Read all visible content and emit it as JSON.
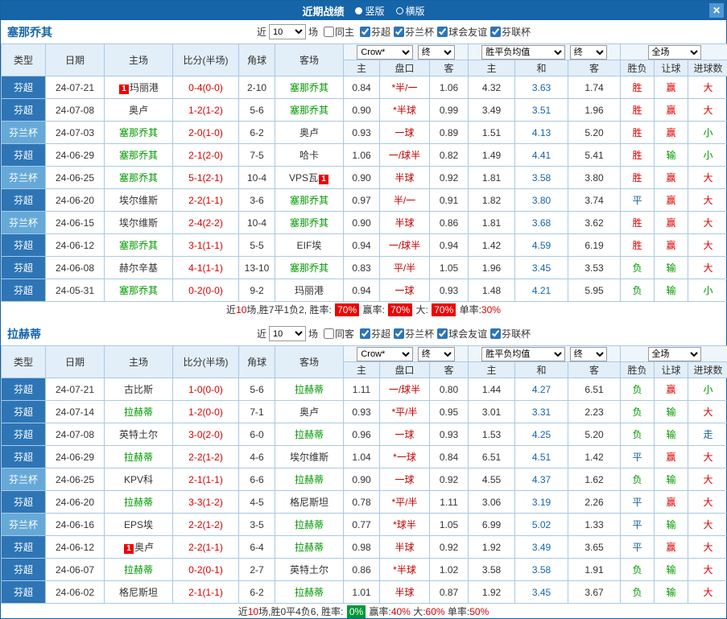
{
  "window": {
    "title": "近期战绩",
    "view_vertical": "竖版",
    "view_horizontal": "横版",
    "close_label": "✕"
  },
  "controls": {
    "near": "近",
    "count": "10",
    "games": "场",
    "bookmaker": "Crow*",
    "final": "终",
    "wdl_avg": "胜平负均值",
    "full": "全场"
  },
  "table_headers": {
    "type": "类型",
    "date": "日期",
    "home": "主场",
    "score": "比分(半场)",
    "corner": "角球",
    "away": "客场",
    "asian_home": "主",
    "handicap": "盘口",
    "asian_away": "客",
    "avg_home": "主",
    "avg_draw": "和",
    "avg_away": "客",
    "wdl": "胜负",
    "let_ball": "让球",
    "goals": "进球数"
  },
  "league_colors": {
    "芬超": "#2e75b6",
    "芬兰杯": "#66a9d8"
  },
  "result_colors": {
    "胜": "#dd0000",
    "平": "#1565a8",
    "负": "#009900",
    "赢": "#dd0000",
    "输": "#009900",
    "走": "#1565a8",
    "大": "#dd0000",
    "小": "#009900"
  },
  "sections": [
    {
      "team": "塞那乔其",
      "same_filter": "同主",
      "league_filters": [
        "芬超",
        "芬兰杯",
        "球会友谊",
        "芬联杯"
      ],
      "rows": [
        {
          "league": "芬超",
          "date": "24-07-21",
          "home": "玛丽港",
          "home_badge": "1",
          "score": "0-4(0-0)",
          "corner": "2-10",
          "away": "塞那乔其",
          "ah_home": "0.84",
          "handicap": "*半/一",
          "ah_away": "1.06",
          "avg_home": "4.32",
          "avg_draw": "3.63",
          "avg_away": "1.74",
          "wdl": "胜",
          "let_ball": "赢",
          "goals": "大"
        },
        {
          "league": "芬超",
          "date": "24-07-08",
          "home": "奥卢",
          "score": "1-2(1-2)",
          "corner": "5-6",
          "away": "塞那乔其",
          "ah_home": "0.90",
          "handicap": "*半球",
          "ah_away": "0.99",
          "avg_home": "3.49",
          "avg_draw": "3.51",
          "avg_away": "1.96",
          "wdl": "胜",
          "let_ball": "赢",
          "goals": "大"
        },
        {
          "league": "芬兰杯",
          "date": "24-07-03",
          "home": "塞那乔其",
          "score": "2-0(1-0)",
          "corner": "6-2",
          "away": "奥卢",
          "ah_home": "0.93",
          "handicap": "一球",
          "ah_away": "0.89",
          "avg_home": "1.51",
          "avg_draw": "4.13",
          "avg_away": "5.20",
          "wdl": "胜",
          "let_ball": "赢",
          "goals": "小"
        },
        {
          "league": "芬超",
          "date": "24-06-29",
          "home": "塞那乔其",
          "score": "2-1(2-0)",
          "corner": "7-5",
          "away": "哈卡",
          "ah_home": "1.06",
          "handicap": "一/球半",
          "ah_away": "0.82",
          "avg_home": "1.49",
          "avg_draw": "4.41",
          "avg_away": "5.41",
          "wdl": "胜",
          "let_ball": "输",
          "goals": "小"
        },
        {
          "league": "芬兰杯",
          "date": "24-06-25",
          "home": "塞那乔其",
          "score": "5-1(2-1)",
          "corner": "10-4",
          "away": "VPS瓦",
          "away_badge": "1",
          "away_badge_after": true,
          "ah_home": "0.90",
          "handicap": "半球",
          "ah_away": "0.92",
          "avg_home": "1.81",
          "avg_draw": "3.58",
          "avg_away": "3.80",
          "wdl": "胜",
          "let_ball": "赢",
          "goals": "大"
        },
        {
          "league": "芬超",
          "date": "24-06-20",
          "home": "埃尔维斯",
          "score": "2-2(1-1)",
          "corner": "3-6",
          "away": "塞那乔其",
          "ah_home": "0.97",
          "handicap": "半/一",
          "ah_away": "0.91",
          "avg_home": "1.82",
          "avg_draw": "3.80",
          "avg_away": "3.74",
          "wdl": "平",
          "let_ball": "赢",
          "goals": "大"
        },
        {
          "league": "芬兰杯",
          "date": "24-06-15",
          "home": "埃尔维斯",
          "score": "2-4(2-2)",
          "corner": "10-4",
          "away": "塞那乔其",
          "ah_home": "0.90",
          "handicap": "半球",
          "ah_away": "0.86",
          "avg_home": "1.81",
          "avg_draw": "3.68",
          "avg_away": "3.62",
          "wdl": "胜",
          "let_ball": "赢",
          "goals": "大"
        },
        {
          "league": "芬超",
          "date": "24-06-12",
          "home": "塞那乔其",
          "score": "3-1(1-1)",
          "corner": "5-5",
          "away": "EIF埃",
          "ah_home": "0.94",
          "handicap": "一/球半",
          "ah_away": "0.94",
          "avg_home": "1.42",
          "avg_draw": "4.59",
          "avg_away": "6.19",
          "wdl": "胜",
          "let_ball": "赢",
          "goals": "大"
        },
        {
          "league": "芬超",
          "date": "24-06-08",
          "home": "赫尔辛基",
          "score": "4-1(1-1)",
          "corner": "13-10",
          "away": "塞那乔其",
          "ah_home": "0.83",
          "handicap": "平/半",
          "ah_away": "1.05",
          "avg_home": "1.96",
          "avg_draw": "3.45",
          "avg_away": "3.53",
          "wdl": "负",
          "let_ball": "输",
          "goals": "大"
        },
        {
          "league": "芬超",
          "date": "24-05-31",
          "home": "塞那乔其",
          "score": "0-2(0-0)",
          "corner": "9-2",
          "away": "玛丽港",
          "ah_home": "0.94",
          "handicap": "一球",
          "ah_away": "0.93",
          "avg_home": "1.48",
          "avg_draw": "4.21",
          "avg_away": "5.95",
          "wdl": "负",
          "let_ball": "输",
          "goals": "小"
        }
      ],
      "summary": [
        {
          "text": "近",
          "style": "plain"
        },
        {
          "text": "10",
          "style": "num"
        },
        {
          "text": "场,胜7平1负2, 胜率: ",
          "style": "plain"
        },
        {
          "text": "70%",
          "style": "box-red"
        },
        {
          "text": " 赢率: ",
          "style": "plain"
        },
        {
          "text": "70%",
          "style": "box-red"
        },
        {
          "text": " 大: ",
          "style": "plain"
        },
        {
          "text": "70%",
          "style": "box-red"
        },
        {
          "text": " 单率:",
          "style": "plain"
        },
        {
          "text": "30%",
          "style": "num"
        }
      ]
    },
    {
      "team": "拉赫蒂",
      "same_filter": "同客",
      "league_filters": [
        "芬超",
        "芬兰杯",
        "球会友谊",
        "芬联杯"
      ],
      "rows": [
        {
          "league": "芬超",
          "date": "24-07-21",
          "home": "古比斯",
          "score": "1-0(0-0)",
          "corner": "5-6",
          "away": "拉赫蒂",
          "ah_home": "1.11",
          "handicap": "一/球半",
          "ah_away": "0.80",
          "avg_home": "1.44",
          "avg_draw": "4.27",
          "avg_away": "6.51",
          "wdl": "负",
          "let_ball": "赢",
          "goals": "小"
        },
        {
          "league": "芬超",
          "date": "24-07-14",
          "home": "拉赫蒂",
          "score": "1-2(0-0)",
          "corner": "7-1",
          "away": "奥卢",
          "ah_home": "0.93",
          "handicap": "*平/半",
          "ah_away": "0.95",
          "avg_home": "3.01",
          "avg_draw": "3.31",
          "avg_away": "2.23",
          "wdl": "负",
          "let_ball": "输",
          "goals": "大"
        },
        {
          "league": "芬超",
          "date": "24-07-08",
          "home": "英特土尔",
          "score": "3-0(2-0)",
          "corner": "6-0",
          "away": "拉赫蒂",
          "ah_home": "0.96",
          "handicap": "一球",
          "ah_away": "0.93",
          "avg_home": "1.53",
          "avg_draw": "4.25",
          "avg_away": "5.20",
          "wdl": "负",
          "let_ball": "输",
          "goals": "走"
        },
        {
          "league": "芬超",
          "date": "24-06-29",
          "home": "拉赫蒂",
          "score": "2-2(1-2)",
          "corner": "4-6",
          "away": "埃尔维斯",
          "ah_home": "1.04",
          "handicap": "*一球",
          "ah_away": "0.84",
          "avg_home": "6.51",
          "avg_draw": "4.51",
          "avg_away": "1.42",
          "wdl": "平",
          "let_ball": "赢",
          "goals": "大"
        },
        {
          "league": "芬兰杯",
          "date": "24-06-25",
          "home": "KPV科",
          "score": "2-1(1-1)",
          "corner": "6-6",
          "away": "拉赫蒂",
          "ah_home": "0.90",
          "handicap": "一球",
          "ah_away": "0.92",
          "avg_home": "4.55",
          "avg_draw": "4.37",
          "avg_away": "1.62",
          "wdl": "负",
          "let_ball": "输",
          "goals": "大"
        },
        {
          "league": "芬超",
          "date": "24-06-20",
          "home": "拉赫蒂",
          "score": "3-3(1-2)",
          "corner": "4-5",
          "away": "格尼斯坦",
          "ah_home": "0.78",
          "handicap": "*平/半",
          "ah_away": "1.11",
          "avg_home": "3.06",
          "avg_draw": "3.19",
          "avg_away": "2.26",
          "wdl": "平",
          "let_ball": "赢",
          "goals": "大"
        },
        {
          "league": "芬兰杯",
          "date": "24-06-16",
          "home": "EPS埃",
          "score": "2-2(1-2)",
          "corner": "3-5",
          "away": "拉赫蒂",
          "ah_home": "0.77",
          "handicap": "*球半",
          "ah_away": "1.05",
          "avg_home": "6.99",
          "avg_draw": "5.02",
          "avg_away": "1.33",
          "wdl": "平",
          "let_ball": "输",
          "goals": "大"
        },
        {
          "league": "芬超",
          "date": "24-06-12",
          "home": "奥卢",
          "home_badge": "1",
          "score": "2-2(1-1)",
          "corner": "6-4",
          "away": "拉赫蒂",
          "ah_home": "0.98",
          "handicap": "半球",
          "ah_away": "0.92",
          "avg_home": "1.92",
          "avg_draw": "3.49",
          "avg_away": "3.65",
          "wdl": "平",
          "let_ball": "赢",
          "goals": "大"
        },
        {
          "league": "芬超",
          "date": "24-06-07",
          "home": "拉赫蒂",
          "score": "0-2(0-1)",
          "corner": "2-7",
          "away": "英特土尔",
          "ah_home": "0.86",
          "handicap": "*半球",
          "ah_away": "1.02",
          "avg_home": "3.58",
          "avg_draw": "3.58",
          "avg_away": "1.91",
          "wdl": "负",
          "let_ball": "输",
          "goals": "大"
        },
        {
          "league": "芬超",
          "date": "24-06-02",
          "home": "格尼斯坦",
          "score": "2-1(1-1)",
          "corner": "6-2",
          "away": "拉赫蒂",
          "ah_home": "1.01",
          "handicap": "半球",
          "ah_away": "0.87",
          "avg_home": "1.92",
          "avg_draw": "3.45",
          "avg_away": "3.67",
          "wdl": "负",
          "let_ball": "输",
          "goals": "大"
        }
      ],
      "summary": [
        {
          "text": "近",
          "style": "plain"
        },
        {
          "text": "10",
          "style": "num"
        },
        {
          "text": "场,胜0平4负6, 胜率: ",
          "style": "plain"
        },
        {
          "text": "0%",
          "style": "box-green"
        },
        {
          "text": " 赢率:",
          "style": "plain"
        },
        {
          "text": "40%",
          "style": "num"
        },
        {
          "text": " 大:",
          "style": "plain"
        },
        {
          "text": "60%",
          "style": "num"
        },
        {
          "text": " 单率:",
          "style": "plain"
        },
        {
          "text": "50%",
          "style": "num"
        }
      ]
    }
  ]
}
